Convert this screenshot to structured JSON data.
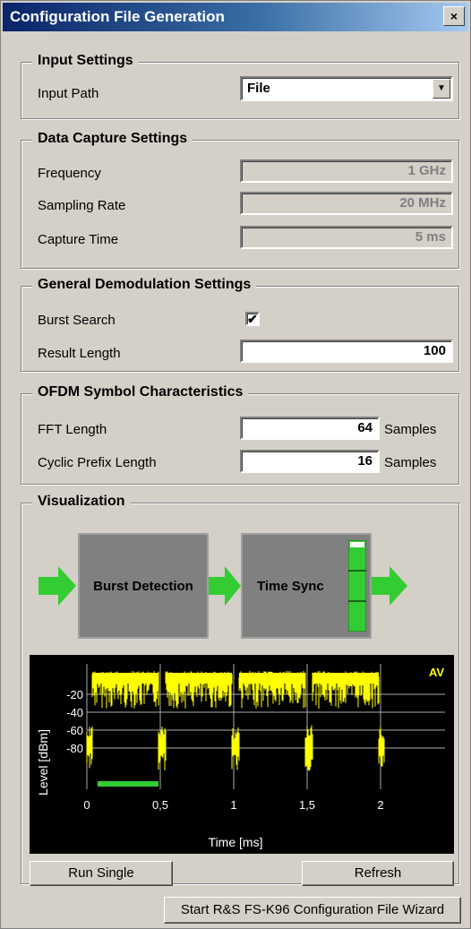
{
  "window": {
    "title": "Configuration File Generation",
    "close_label": "×"
  },
  "input_settings": {
    "legend": "Input Settings",
    "input_path_label": "Input Path",
    "input_path_value": "File"
  },
  "capture": {
    "legend": "Data Capture Settings",
    "frequency_label": "Frequency",
    "frequency_value": "1 GHz",
    "sampling_label": "Sampling Rate",
    "sampling_value": "20 MHz",
    "capture_label": "Capture Time",
    "capture_value": "5 ms"
  },
  "demod": {
    "legend": "General Demodulation Settings",
    "burst_label": "Burst Search",
    "burst_checked": "✔",
    "result_label": "Result Length",
    "result_value": "100"
  },
  "ofdm": {
    "legend": "OFDM Symbol Characteristics",
    "fft_label": "FFT Length",
    "fft_value": "64",
    "fft_unit": "Samples",
    "cp_label": "Cyclic Prefix Length",
    "cp_value": "16",
    "cp_unit": "Samples"
  },
  "viz": {
    "legend": "Visualization",
    "block1": "Burst Detection",
    "block2": "Time Sync",
    "trace_label": "AV",
    "ylabel": "Level [dBm]",
    "xlabel": "Time [ms]",
    "yticks": [
      "-20",
      "-40",
      "-60",
      "-80"
    ],
    "xticks": [
      "0",
      "0,5",
      "1",
      "1,5",
      "2"
    ],
    "run_label": "Run Single",
    "refresh_label": "Refresh"
  },
  "wizard_label": "Start R&S FS-K96 Configuration File Wizard",
  "colors": {
    "accent_green": "#33cc33",
    "trace": "#ffff00",
    "plot_bg": "#000000"
  }
}
